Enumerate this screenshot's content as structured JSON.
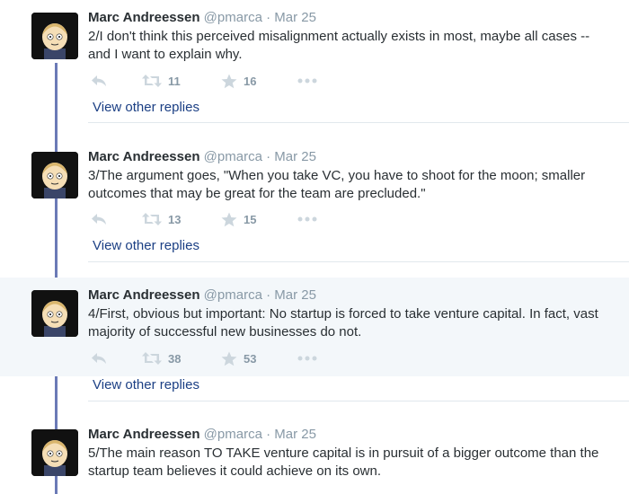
{
  "tweets": [
    {
      "name": "Marc Andreessen",
      "handle": "@pmarca",
      "separator": "·",
      "date": "Mar 25",
      "text": "2/I don't think this perceived misalignment actually exists in most, maybe all cases -- and I want to explain why.",
      "retweets": "11",
      "favorites": "16",
      "view_replies": "View other replies"
    },
    {
      "name": "Marc Andreessen",
      "handle": "@pmarca",
      "separator": "·",
      "date": "Mar 25",
      "text": "3/The argument goes, \"When you take VC, you have to shoot for the moon; smaller outcomes that may be great for the team are precluded.\"",
      "retweets": "13",
      "favorites": "15",
      "view_replies": "View other replies"
    },
    {
      "name": "Marc Andreessen",
      "handle": "@pmarca",
      "separator": "·",
      "date": "Mar 25",
      "text": "4/First, obvious but important: No startup is forced to take venture capital. In fact, vast majority of successful new businesses do not.",
      "retweets": "38",
      "favorites": "53",
      "view_replies": "View other replies"
    },
    {
      "name": "Marc Andreessen",
      "handle": "@pmarca",
      "separator": "·",
      "date": "Mar 25",
      "text": "5/The main reason TO TAKE venture capital is in pursuit of a bigger outcome than the startup team believes it could achieve on its own."
    }
  ],
  "colors": {
    "thread_line": "#6b7ab6",
    "link": "#1b3f84",
    "muted": "#8899a6",
    "highlight_bg": "#f3f7fa"
  }
}
